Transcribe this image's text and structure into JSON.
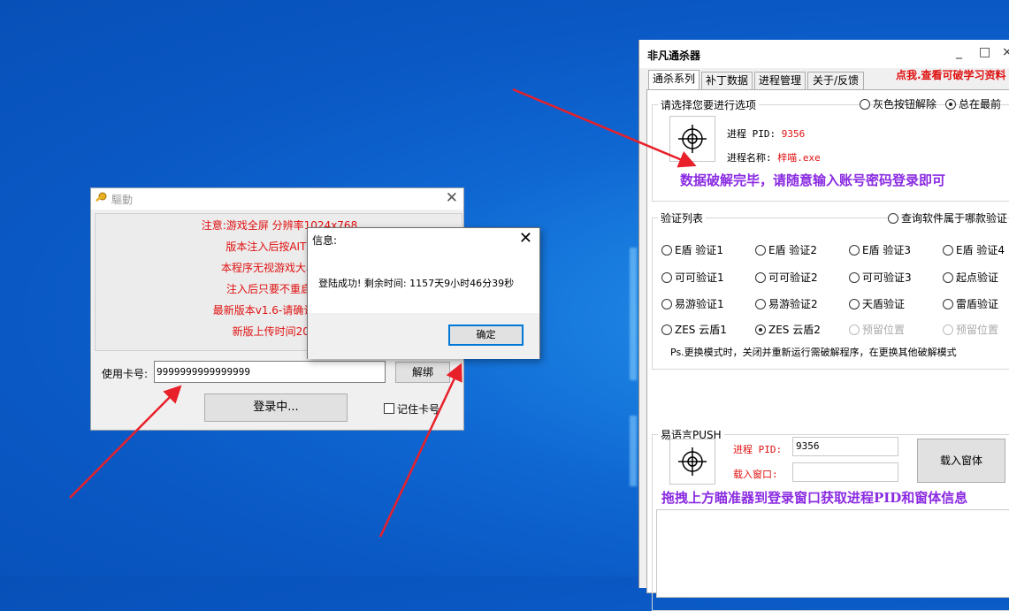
{
  "login_window": {
    "title": "驅動",
    "notices": [
      "注意:游戏全屏    分辨率1024x768",
      "版本注入后按AIT+Z呈",
      "本程序无视游戏大小更新",
      "注入后只要不重启电脑",
      "最新版本v1.6-请确认网盘版",
      "新版上传时间2021-"
    ],
    "card_label": "使用卡号:",
    "card_value": "9999999999999999",
    "unbind_button": "解绑",
    "login_button": "登录中...",
    "remember_label": "记住卡号"
  },
  "info_dialog": {
    "title": "信息:",
    "message": "登陆成功! 剩余时间: 1157天9小时46分39秒",
    "ok_button": "确定"
  },
  "tool_window": {
    "title": "非凡通杀器",
    "tabs": [
      "通杀系列",
      "补丁数据",
      "进程管理",
      "关于/反馈"
    ],
    "promo_link": "点我.查看可破学习资料",
    "select_group": {
      "title": "请选择您要进行选项",
      "gray_button_unlock": "灰色按钮解除",
      "always_on_top": "总在最前",
      "pid_label": "进程 PID:",
      "pid_value": "9356",
      "process_name_label": "进程名称:",
      "process_name_value": "梓喵.exe",
      "banner": "数据破解完毕，请随意输入账号密码登录即可"
    },
    "verify_group": {
      "title": "验证列表",
      "query_label": "查询软件属于哪款验证",
      "options": [
        "E盾 验证1",
        "E盾 验证2",
        "E盾 验证3",
        "E盾 验证4",
        "可可验证1",
        "可可验证2",
        "可可验证3",
        "起点验证",
        "易游验证1",
        "易游验证2",
        "天盾验证",
        "雷盾验证",
        "ZES 云盾1",
        "ZES 云盾2",
        "预留位置",
        "预留位置"
      ],
      "note": "Ps.更换模式时，关闭并重新运行需破解程序，在更换其他破解模式"
    },
    "push_group": {
      "title": "易语言PUSH",
      "pid_label": "进程 PID:",
      "pid_value": "9356",
      "window_label": "载入窗口:",
      "window_value": "",
      "load_button": "载入窗体",
      "banner": "拖拽上方瞄准器到登录窗口获取进程PID和窗体信息"
    },
    "window_buttons": [
      "_",
      "□",
      "×"
    ]
  },
  "colors": {
    "accent_red": "#e01010",
    "banner_purple": "#8a2be2",
    "desktop_blue": "#0f67d2"
  }
}
